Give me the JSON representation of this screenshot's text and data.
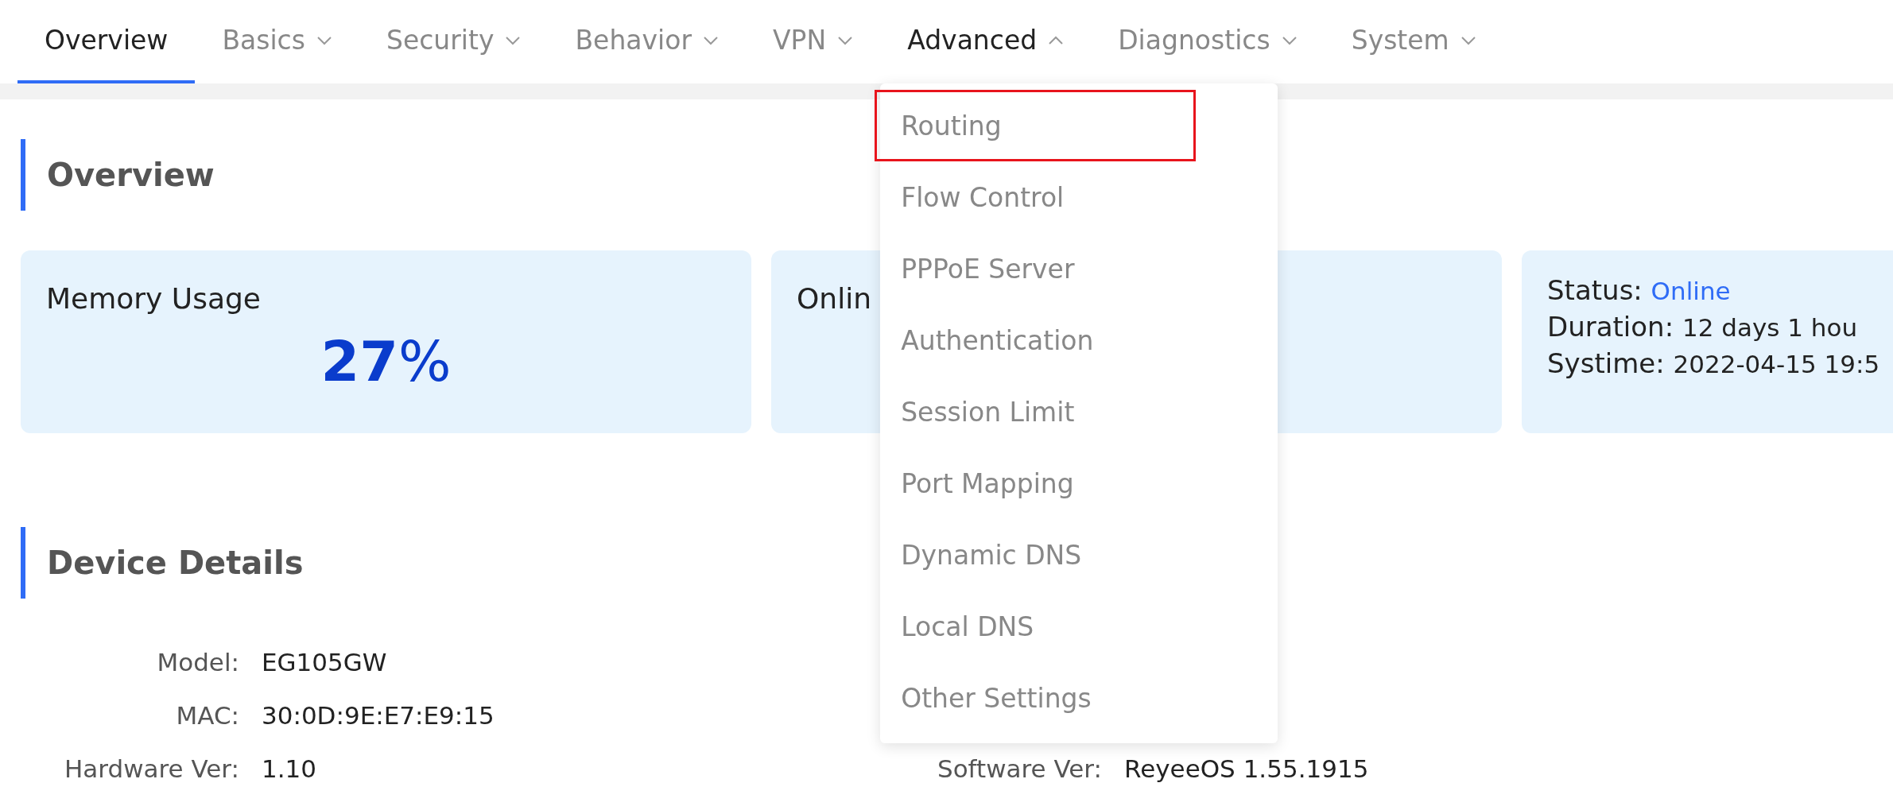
{
  "nav": {
    "tabs": [
      {
        "label": "Overview",
        "selected": true,
        "has_menu": false,
        "open": false
      },
      {
        "label": "Basics",
        "selected": false,
        "has_menu": true,
        "open": false
      },
      {
        "label": "Security",
        "selected": false,
        "has_menu": true,
        "open": false
      },
      {
        "label": "Behavior",
        "selected": false,
        "has_menu": true,
        "open": false
      },
      {
        "label": "VPN",
        "selected": false,
        "has_menu": true,
        "open": false
      },
      {
        "label": "Advanced",
        "selected": false,
        "has_menu": true,
        "open": true
      },
      {
        "label": "Diagnostics",
        "selected": false,
        "has_menu": true,
        "open": false
      },
      {
        "label": "System",
        "selected": false,
        "has_menu": true,
        "open": false
      }
    ]
  },
  "dropdown": {
    "items": [
      {
        "label": "Routing",
        "highlighted": true
      },
      {
        "label": "Flow Control",
        "highlighted": false
      },
      {
        "label": "PPPoE Server",
        "highlighted": false
      },
      {
        "label": "Authentication",
        "highlighted": false
      },
      {
        "label": "Session Limit",
        "highlighted": false
      },
      {
        "label": "Port Mapping",
        "highlighted": false
      },
      {
        "label": "Dynamic DNS",
        "highlighted": false
      },
      {
        "label": "Local DNS",
        "highlighted": false
      },
      {
        "label": "Other Settings",
        "highlighted": false
      }
    ]
  },
  "overview": {
    "title": "Overview",
    "cards": [
      {
        "kind": "metric",
        "title": "Memory Usage",
        "number": "27",
        "unit": "%"
      },
      {
        "kind": "metric",
        "title": "Onlin"
      },
      {
        "kind": "status",
        "lines": [
          {
            "label": "Status:",
            "value": "Online",
            "link": true
          },
          {
            "label": "Duration:",
            "value": "12 days 1 hou",
            "link": false
          },
          {
            "label": "Systime:",
            "value": "2022-04-15 19:5",
            "link": false
          }
        ]
      }
    ]
  },
  "device_details": {
    "title": "Device Details",
    "left": [
      {
        "label": "Model:",
        "value": "EG105GW"
      },
      {
        "label": "MAC:",
        "value": "30:0D:9E:E7:E9:15"
      },
      {
        "label": "Hardware Ver:",
        "value": "1.10"
      }
    ],
    "right": [
      {
        "label": "Software Ver:",
        "value": "ReyeeOS 1.55.1915"
      }
    ]
  }
}
